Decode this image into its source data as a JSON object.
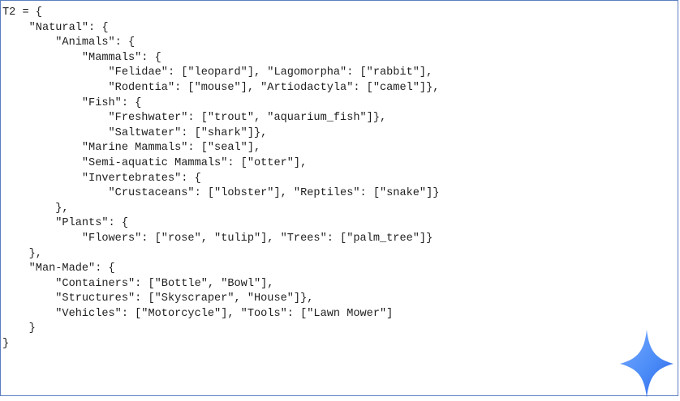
{
  "code": {
    "lines": [
      "T2 = {",
      "    \"Natural\": {",
      "        \"Animals\": {",
      "            \"Mammals\": {",
      "                \"Felidae\": [\"leopard\"], \"Lagomorpha\": [\"rabbit\"],",
      "                \"Rodentia\": [\"mouse\"], \"Artiodactyla\": [\"camel\"]},",
      "            \"Fish\": {",
      "                \"Freshwater\": [\"trout\", \"aquarium_fish\"]},",
      "                \"Saltwater\": [\"shark\"]},",
      "            \"Marine Mammals\": [\"seal\"],",
      "            \"Semi-aquatic Mammals\": [\"otter\"],",
      "            \"Invertebrates\": {",
      "                \"Crustaceans\": [\"lobster\"], \"Reptiles\": [\"snake\"]}",
      "        },",
      "        \"Plants\": {",
      "            \"Flowers\": [\"rose\", \"tulip\"], \"Trees\": [\"palm_tree\"]}",
      "    },",
      "    \"Man-Made\": {",
      "        \"Containers\": [\"Bottle\", \"Bowl\"],",
      "        \"Structures\": [\"Skyscraper\", \"House\"]},",
      "        \"Vehicles\": [\"Motorcycle\"], \"Tools\": [\"Lawn Mower\"]",
      "    }",
      "}"
    ]
  },
  "icon": {
    "name": "sparkle-icon",
    "colors": [
      "#4a8cf7",
      "#2f5fe8",
      "#7aa9ff"
    ]
  },
  "colors": {
    "border": "#5b7fc0",
    "text": "#1f1f1f",
    "background": "#ffffff"
  }
}
